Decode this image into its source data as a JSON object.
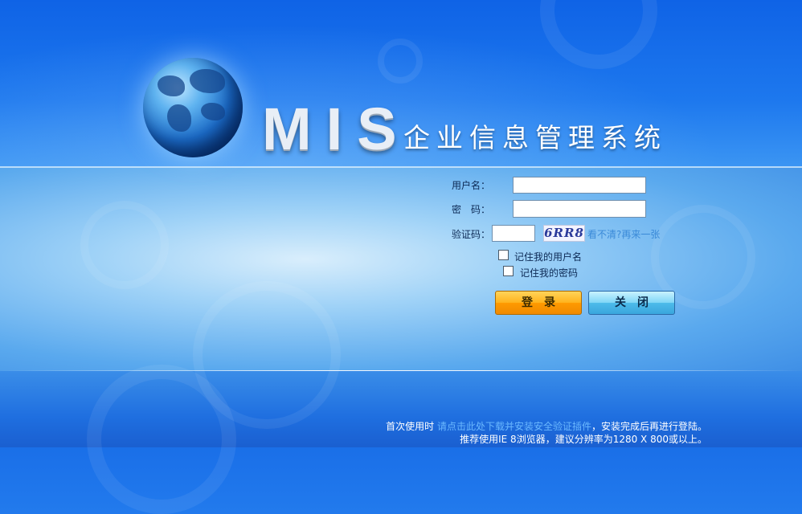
{
  "brand": {
    "mis": "MIS",
    "title": "企业信息管理系统"
  },
  "form": {
    "username_label": "用户名：",
    "username_value": "",
    "password_label": "密　码：",
    "password_value": "",
    "captcha_label": "验证码：",
    "captcha_value": "",
    "captcha_text": "6RR8",
    "refresh_link": "看不清?再来一张",
    "remember_user": "记住我的用户名",
    "remember_password": "记住我的密码"
  },
  "buttons": {
    "login": "登录",
    "close": "关闭"
  },
  "footer": {
    "line1_prefix": "首次使用时",
    "line1_link1": "请点击此处下载并安装",
    "line1_link2": "安全验证插件",
    "line1_suffix": "，安装完成后再进行登陆。",
    "line2": "推荐使用IE 8浏览器，建议分辨率为1280 X 800或以上。"
  }
}
